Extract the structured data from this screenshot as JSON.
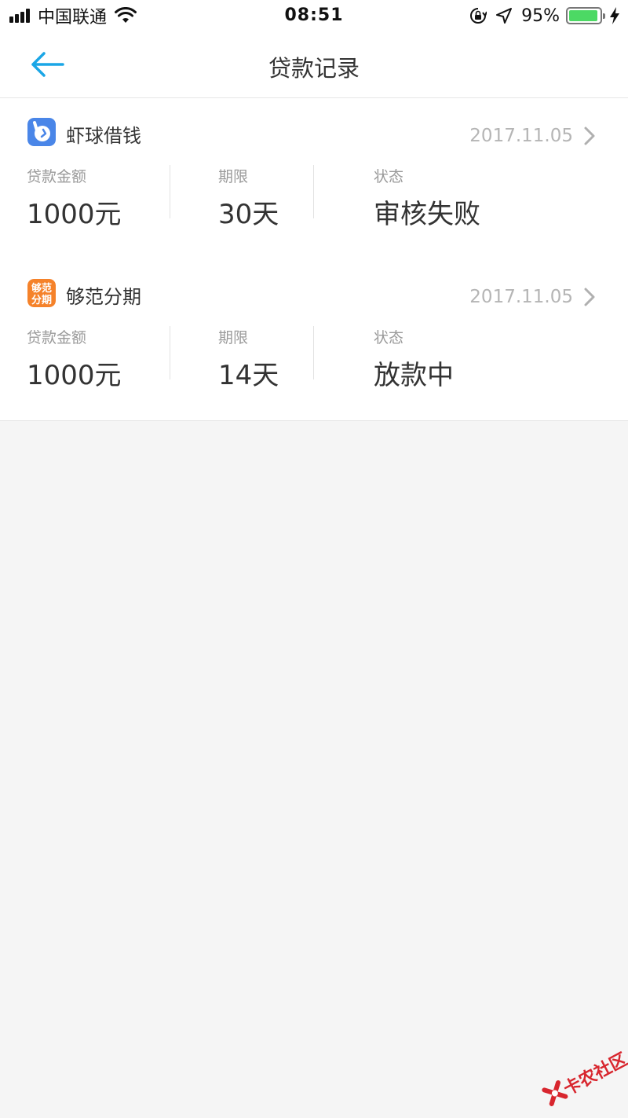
{
  "status_bar": {
    "carrier": "中国联通",
    "time": "08:51",
    "battery_percent": "95%",
    "battery_level": 0.95,
    "battery_color": "#4cd964"
  },
  "nav": {
    "title": "贷款记录",
    "back_icon": "back-arrow-icon",
    "accent_color": "#1aa6e6"
  },
  "records": [
    {
      "app_name": "虾球借钱",
      "date": "2017.11.05",
      "icon": "xiaqiu-logo-icon",
      "icon_color": "#4a86e8",
      "amount_label": "贷款金额",
      "amount": "1000元",
      "term_label": "期限",
      "term": "30天",
      "status_label": "状态",
      "status": "审核失败"
    },
    {
      "app_name": "够范分期",
      "date": "2017.11.05",
      "icon": "goufan-logo-icon",
      "icon_color": "#f5822a",
      "icon_text": "够范分期",
      "amount_label": "贷款金额",
      "amount": "1000元",
      "term_label": "期限",
      "term": "14天",
      "status_label": "状态",
      "status": "放款中"
    }
  ],
  "watermark": {
    "text": "卡农社区"
  }
}
